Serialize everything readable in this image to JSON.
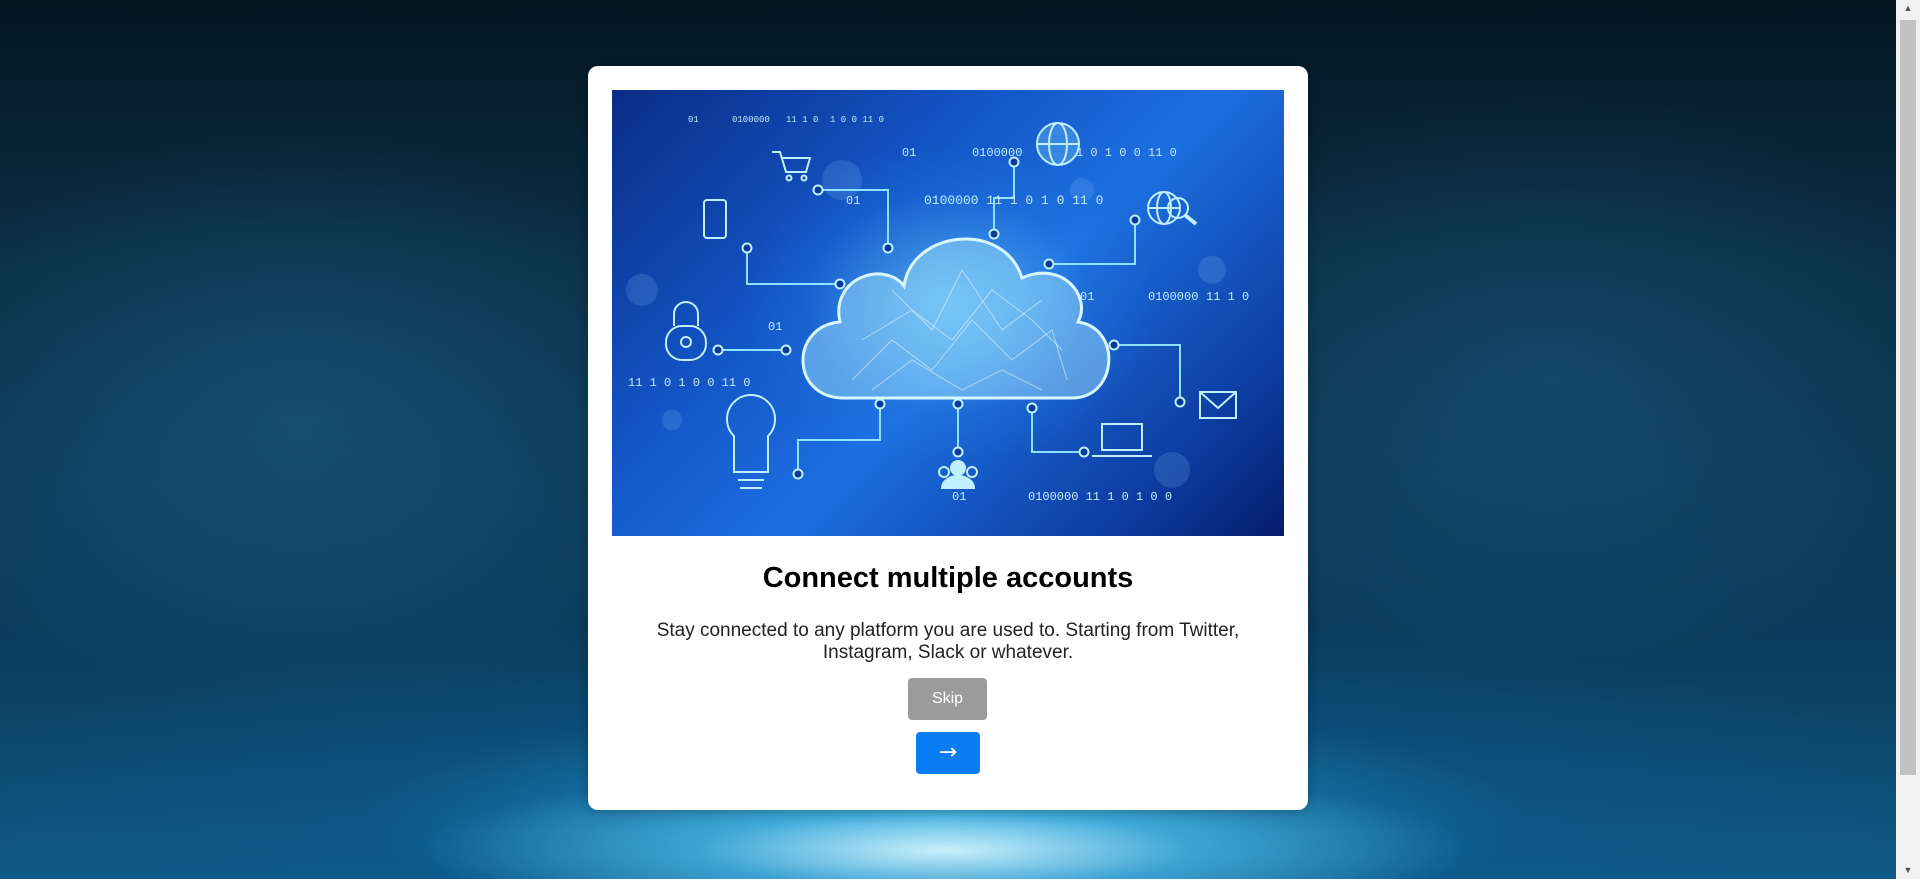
{
  "onboarding": {
    "title": "Connect multiple accounts",
    "description": "Stay connected to any platform you are used to. Starting from Twitter, Instagram, Slack or whatever.",
    "skip_label": "Skip",
    "next_label": "→"
  },
  "hero": {
    "icons": [
      "shopping-cart-icon",
      "globe-icon",
      "smartphone-icon",
      "globe-search-icon",
      "padlock-icon",
      "envelope-icon",
      "lightbulb-icon",
      "laptop-icon",
      "users-icon",
      "cloud-icon"
    ],
    "binary_text": [
      "01",
      "0100000",
      "11 1 0",
      "1 0 0 11 0",
      "01",
      "0100000",
      "11 1 0",
      "1 0",
      "0100000",
      "11 1 0",
      "01",
      "11 1 0",
      "1 0 0 11 0",
      "01",
      "0100000",
      "11 1 0",
      "1 0 0"
    ]
  },
  "colors": {
    "next_button": "#0a7cf4",
    "skip_button": "#9b9b9b"
  }
}
